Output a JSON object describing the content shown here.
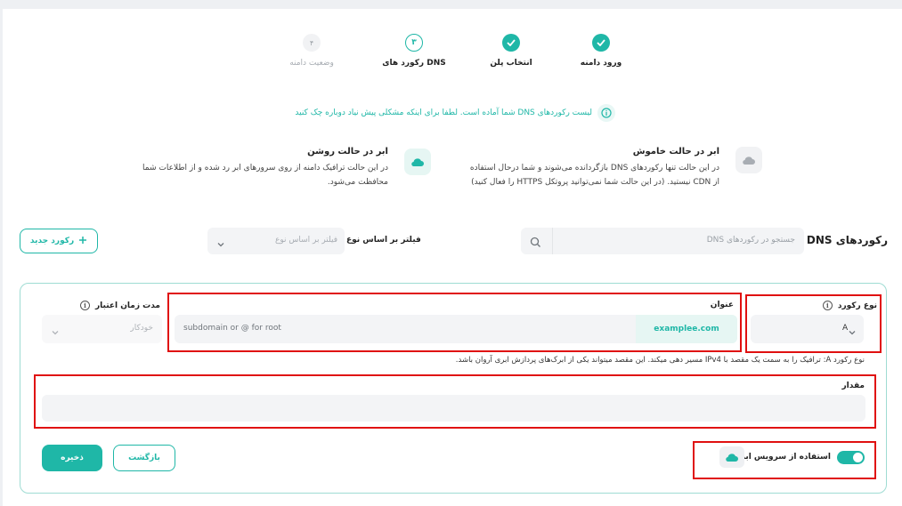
{
  "stepper": {
    "steps": [
      {
        "label": "ورود دامنه",
        "state": "done",
        "marker": ""
      },
      {
        "label": "انتخاب پلن",
        "state": "done",
        "marker": ""
      },
      {
        "label": "رکورد های DNS",
        "state": "current",
        "marker": "۳"
      },
      {
        "label": "وضعیت دامنه",
        "state": "todo",
        "marker": "۴"
      }
    ]
  },
  "notice": {
    "text": "لیست رکوردهای DNS شما آماده است. لطفا برای اینکه مشکلی پیش نیاد دوباره چک کنید",
    "icon": "info-icon"
  },
  "cloud_options": {
    "off": {
      "title": "ابر در حالت خاموش",
      "desc1": "در این حالت تنها رکوردهای DNS بازگردانده می‌شوند و شما درحال استفاده",
      "desc2": "از CDN نیستید. (در این حالت شما نمی‌توانید پروتکل HTTPS را فعال کنید)",
      "icon": "cloud-off-icon"
    },
    "on": {
      "title": "ابر در حالت روشن",
      "desc1": "در این حالت ترافیک دامنه از روی سرورهای ابر رد شده و از اطلاعات شما",
      "desc2": "محافظت می‌شود.",
      "icon": "cloud-on-icon"
    }
  },
  "dns_section": {
    "title": "رکوردهای DNS",
    "search_placeholder": "جستجو در رکوردهای DNS",
    "filter_label": "فیلتر بر اساس نوع",
    "filter_placeholder": "فیلتر بر اساس نوع",
    "new_record_label": "رکورد جدید"
  },
  "form": {
    "record_type_label": "نوع رکورد",
    "record_type_value": "A",
    "name_label": "عنوان",
    "name_placeholder": "subdomain or @ for root",
    "name_suffix": "examplee.com",
    "ttl_label": "مدت زمان اعتبار",
    "ttl_value": "خودکار",
    "hint": "نوع رکورد A: ترافیک را به سمت یک مقصد با IPv4 مسیر دهی میکند. این مقصد میتواند یکی از ابرک‌های پردازش ابری آروان باشد.",
    "value_label": "مقدار",
    "cloud_toggle_label": "استفاده از سرویس ابری",
    "cloud_toggle_on": true,
    "back_label": "بازگشت",
    "save_label": "ذخیره"
  },
  "colors": {
    "accent": "#1fb7a7",
    "highlight": "#e01010"
  }
}
